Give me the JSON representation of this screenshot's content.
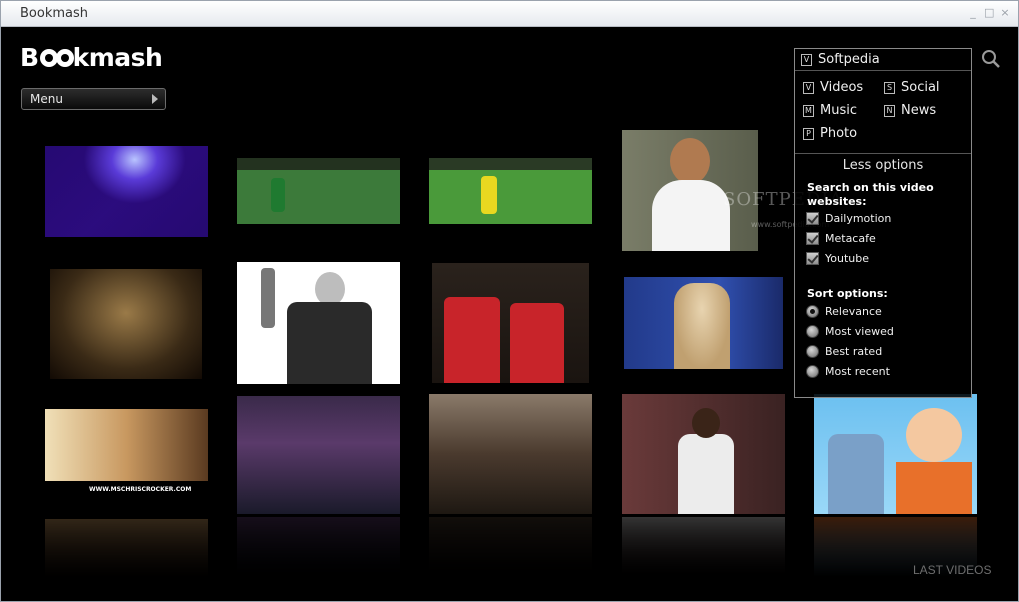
{
  "window": {
    "title": "Bookmash"
  },
  "logo": {
    "prefix": "B",
    "suffix": "kmash"
  },
  "menu": {
    "label": "Menu"
  },
  "panel": {
    "source": {
      "key": "V",
      "label": "Softpedia"
    },
    "categories": [
      {
        "key": "V",
        "label": "Videos"
      },
      {
        "key": "S",
        "label": "Social"
      },
      {
        "key": "M",
        "label": "Music"
      },
      {
        "key": "N",
        "label": "News"
      },
      {
        "key": "P",
        "label": "Photo"
      }
    ],
    "less_options": "Less options",
    "sites_title": "Search on this video websites:",
    "sites": [
      {
        "label": "Dailymotion",
        "checked": true
      },
      {
        "label": "Metacafe",
        "checked": true
      },
      {
        "label": "Youtube",
        "checked": true
      }
    ],
    "sort_title": "Sort options:",
    "sort": [
      {
        "label": "Relevance",
        "selected": true
      },
      {
        "label": "Most viewed",
        "selected": false
      },
      {
        "label": "Best rated",
        "selected": false
      },
      {
        "label": "Most recent",
        "selected": false
      }
    ]
  },
  "watermark": {
    "main": "SOFTPEDIA",
    "sub": "www.softpedia.com"
  },
  "footer": {
    "last_videos": "LAST VIDEOS"
  },
  "thumb_captions": {
    "t9": "WWW.MSCHRISCROCKER.COM"
  },
  "thumbnails": [
    {
      "name": "concert-stage",
      "colors": [
        "#1a0a5a",
        "#6a2bd8",
        "#2a0f6e"
      ]
    },
    {
      "name": "football-match-1",
      "colors": [
        "#2b6a35",
        "#4a8a3e",
        "#1c4a25"
      ]
    },
    {
      "name": "football-match-2",
      "colors": [
        "#3d8a2e",
        "#5aa83d",
        "#2a6a22"
      ]
    },
    {
      "name": "singer-portrait",
      "colors": [
        "#6b6e5a",
        "#ffffff",
        "#3a2a1e"
      ]
    },
    {
      "name": "dark-performer",
      "colors": [
        "#2a1a0a",
        "#8a6a3a",
        "#1a0f05"
      ]
    },
    {
      "name": "politician-dance",
      "colors": [
        "#ffffff",
        "#d8d8d8",
        "#2a2a2a"
      ]
    },
    {
      "name": "basketball-players",
      "colors": [
        "#3a2a22",
        "#c0282a",
        "#1e1410"
      ]
    },
    {
      "name": "blonde-singer",
      "colors": [
        "#1a2a6a",
        "#d8c098",
        "#2a3a8a"
      ]
    },
    {
      "name": "blonde-woman",
      "colors": [
        "#c8b090",
        "#e8d8b0",
        "#5a3a2a"
      ]
    },
    {
      "name": "stage-crowd",
      "colors": [
        "#3a2a4a",
        "#7a5a8a",
        "#1a1a2a"
      ]
    },
    {
      "name": "crowd-event",
      "colors": [
        "#5a4a3a",
        "#9a8a7a",
        "#2a221a"
      ]
    },
    {
      "name": "woman-white-coat",
      "colors": [
        "#5a3a3a",
        "#e0e0e0",
        "#2a1a1a"
      ]
    },
    {
      "name": "anime-characters",
      "colors": [
        "#4aa0d8",
        "#e87a30",
        "#8ac8e8"
      ]
    }
  ]
}
